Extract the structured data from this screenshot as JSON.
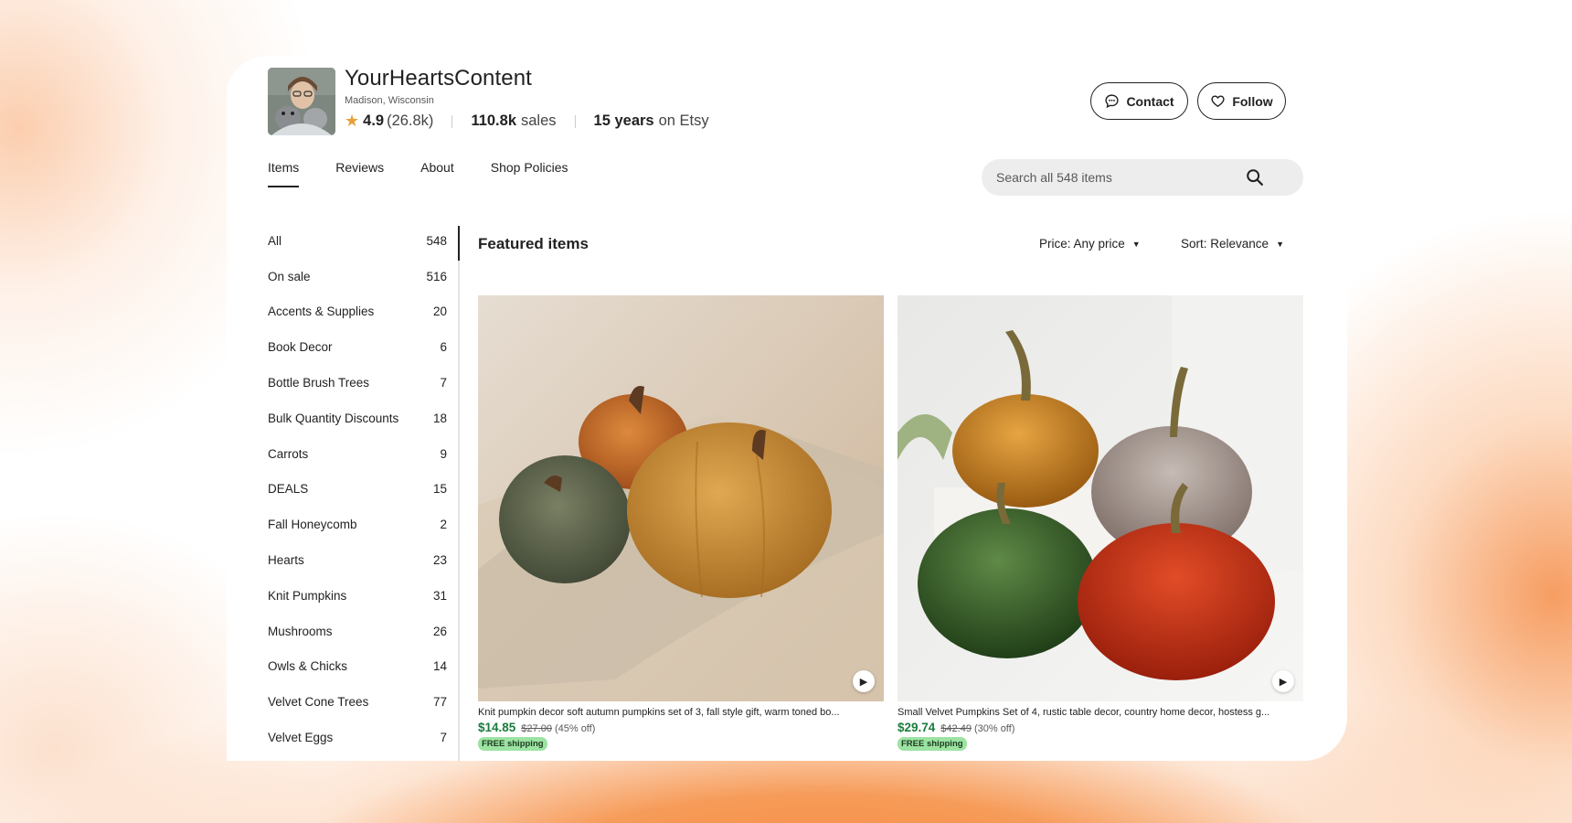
{
  "shop": {
    "name": "YourHeartsContent",
    "location": "Madison, Wisconsin",
    "rating": "4.9",
    "review_count": "(26.8k)",
    "sales_value": "110.8k",
    "sales_label": "sales",
    "years_value": "15 years",
    "years_label": "on Etsy"
  },
  "header_buttons": {
    "contact": "Contact",
    "follow": "Follow"
  },
  "tabs": [
    {
      "label": "Items",
      "active": true
    },
    {
      "label": "Reviews",
      "active": false
    },
    {
      "label": "About",
      "active": false
    },
    {
      "label": "Shop Policies",
      "active": false
    }
  ],
  "search": {
    "placeholder": "Search all 548 items"
  },
  "sidebar": {
    "categories": [
      {
        "label": "All",
        "count": "548"
      },
      {
        "label": "On sale",
        "count": "516"
      },
      {
        "label": "Accents & Supplies",
        "count": "20"
      },
      {
        "label": "Book Decor",
        "count": "6"
      },
      {
        "label": "Bottle Brush Trees",
        "count": "7"
      },
      {
        "label": "Bulk Quantity Discounts",
        "count": "18"
      },
      {
        "label": "Carrots",
        "count": "9"
      },
      {
        "label": "DEALS",
        "count": "15"
      },
      {
        "label": "Fall Honeycomb",
        "count": "2"
      },
      {
        "label": "Hearts",
        "count": "23"
      },
      {
        "label": "Knit Pumpkins",
        "count": "31"
      },
      {
        "label": "Mushrooms",
        "count": "26"
      },
      {
        "label": "Owls & Chicks",
        "count": "14"
      },
      {
        "label": "Velvet Cone Trees",
        "count": "77"
      },
      {
        "label": "Velvet Eggs",
        "count": "7"
      }
    ]
  },
  "main": {
    "section_title": "Featured items",
    "price_filter": "Price: Any price",
    "sort": "Sort: Relevance",
    "listings": [
      {
        "title": "Knit pumpkin decor soft autumn pumpkins set of 3, fall style gift, warm toned bo...",
        "price": "$14.85",
        "original_price": "$27.00",
        "discount": "(45% off)",
        "shipping": "FREE shipping"
      },
      {
        "title": "Small Velvet Pumpkins Set of 4, rustic table decor, country home decor, hostess g...",
        "price": "$29.74",
        "original_price": "$42.49",
        "discount": "(30% off)",
        "shipping": "FREE shipping"
      }
    ]
  },
  "colors": {
    "price_green": "#1a7d3c",
    "free_shipping_bg": "#9ce3a2",
    "star": "#e8a03a",
    "background_accent": "#f58a3c"
  },
  "icons": [
    "star-icon",
    "chat-icon",
    "heart-icon",
    "search-icon",
    "caret-down-icon",
    "play-icon"
  ]
}
